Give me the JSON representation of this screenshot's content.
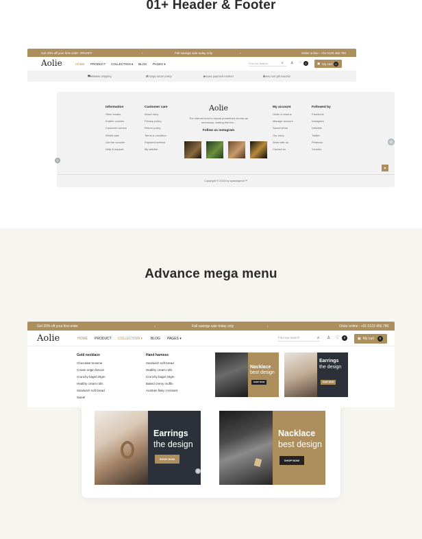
{
  "section1": {
    "title": "01+ Header & Footer",
    "header": {
      "announcement": {
        "left": "Get 20% off your first order: 20%OFF",
        "center": "Fall savings sale today only",
        "right": "Order online : +01 0123 456 789"
      },
      "logo": "Aolie",
      "menu": [
        "HOME",
        "PRODUCT",
        "COLLECTION ▾",
        "BLOG",
        "PAGES ▾"
      ],
      "search_placeholder": "Find our search",
      "wishlist_count": "0",
      "cart_label": "My cart",
      "cart_count": "0",
      "features": [
        "Worldwide shipping",
        "30 Days return policy",
        "Secure payment method",
        "Every root gift voucher"
      ]
    },
    "footer": {
      "information": {
        "title": "Information",
        "items": [
          "Store locator",
          "Enable cookies",
          "Customer service",
          "Whole sale",
          "Get the voucher",
          "Help & support"
        ]
      },
      "customer_care": {
        "title": "Customer care",
        "items": [
          "About story",
          "Privacy policy",
          "Return policy",
          "Terms & condition",
          "Payment method",
          "My wishlist"
        ]
      },
      "logo": "Aolie",
      "description": "The internet tend to repeat predefined chunks as necessary, making this the...",
      "instagram_title": "Follow us instagram",
      "my_account": {
        "title": "My account",
        "items": [
          "Order & returns",
          "Manage account",
          "Saved items",
          "Our story",
          "Work with us",
          "Contact us"
        ]
      },
      "followed_by": {
        "title": "Followed by",
        "items": [
          "Facebook",
          "Instagram",
          "Dribbble",
          "Twitter",
          "Pinterest",
          "Youtube"
        ]
      },
      "copyright": "Copyright © 2023 by spacingtech™",
      "back_to_top": "▲"
    }
  },
  "section2": {
    "title": "Advance mega menu",
    "header": {
      "announcement": {
        "left": "Get 20% off your first order",
        "center": "Fall savings sale today only",
        "right": "Order online : +01 0123 456 789",
        "prev": "‹",
        "next": "›"
      },
      "logo": "Aolie",
      "menu": [
        "HOME",
        "PRODUCT",
        "COLLECTION ▾",
        "BLOG",
        "PAGES ▾"
      ],
      "search_placeholder": "Find our search",
      "wishlist_count": "0",
      "cart_label": "My cart",
      "cart_count": "0"
    },
    "mega_menu": {
      "col1": {
        "title": "Gold necklace",
        "items": [
          "Chocolate brownie",
          "Cream origin biscuit",
          "Crunchy bagel 20gm",
          "Healthy cream rolls",
          "Sandwich soft bread",
          "Sweet"
        ]
      },
      "col2": {
        "title": "Hand harness",
        "items": [
          "Sandwich soft bread",
          "Healthy cream rolls",
          "Crunchy bagel 20gm",
          "Baked cremy muffin",
          "Austrian flaky croissant",
          ""
        ]
      },
      "banner1": {
        "line1": "Nacklace",
        "line2": "best design",
        "button": "SHOP NOW"
      },
      "banner2": {
        "line1": "Earrings",
        "line2": "the design",
        "button": "SHOP NOW"
      }
    },
    "zoom_banners": {
      "left": {
        "line1": "Earrings",
        "line2": "the design",
        "button": "SHOP NOW"
      },
      "right": {
        "line1": "Nacklace",
        "line2": "best design",
        "button": "SHOP NOW"
      }
    }
  },
  "colors": {
    "accent": "#ad8e5d",
    "dark_panel": "#2c3038",
    "section_bg": "#f6f5f0",
    "footer_bg": "#f2f2f2"
  },
  "icons": [
    "truck-icon",
    "return-icon",
    "lock-icon",
    "gift-icon",
    "search-icon",
    "user-icon",
    "heart-icon",
    "cart-icon"
  ]
}
